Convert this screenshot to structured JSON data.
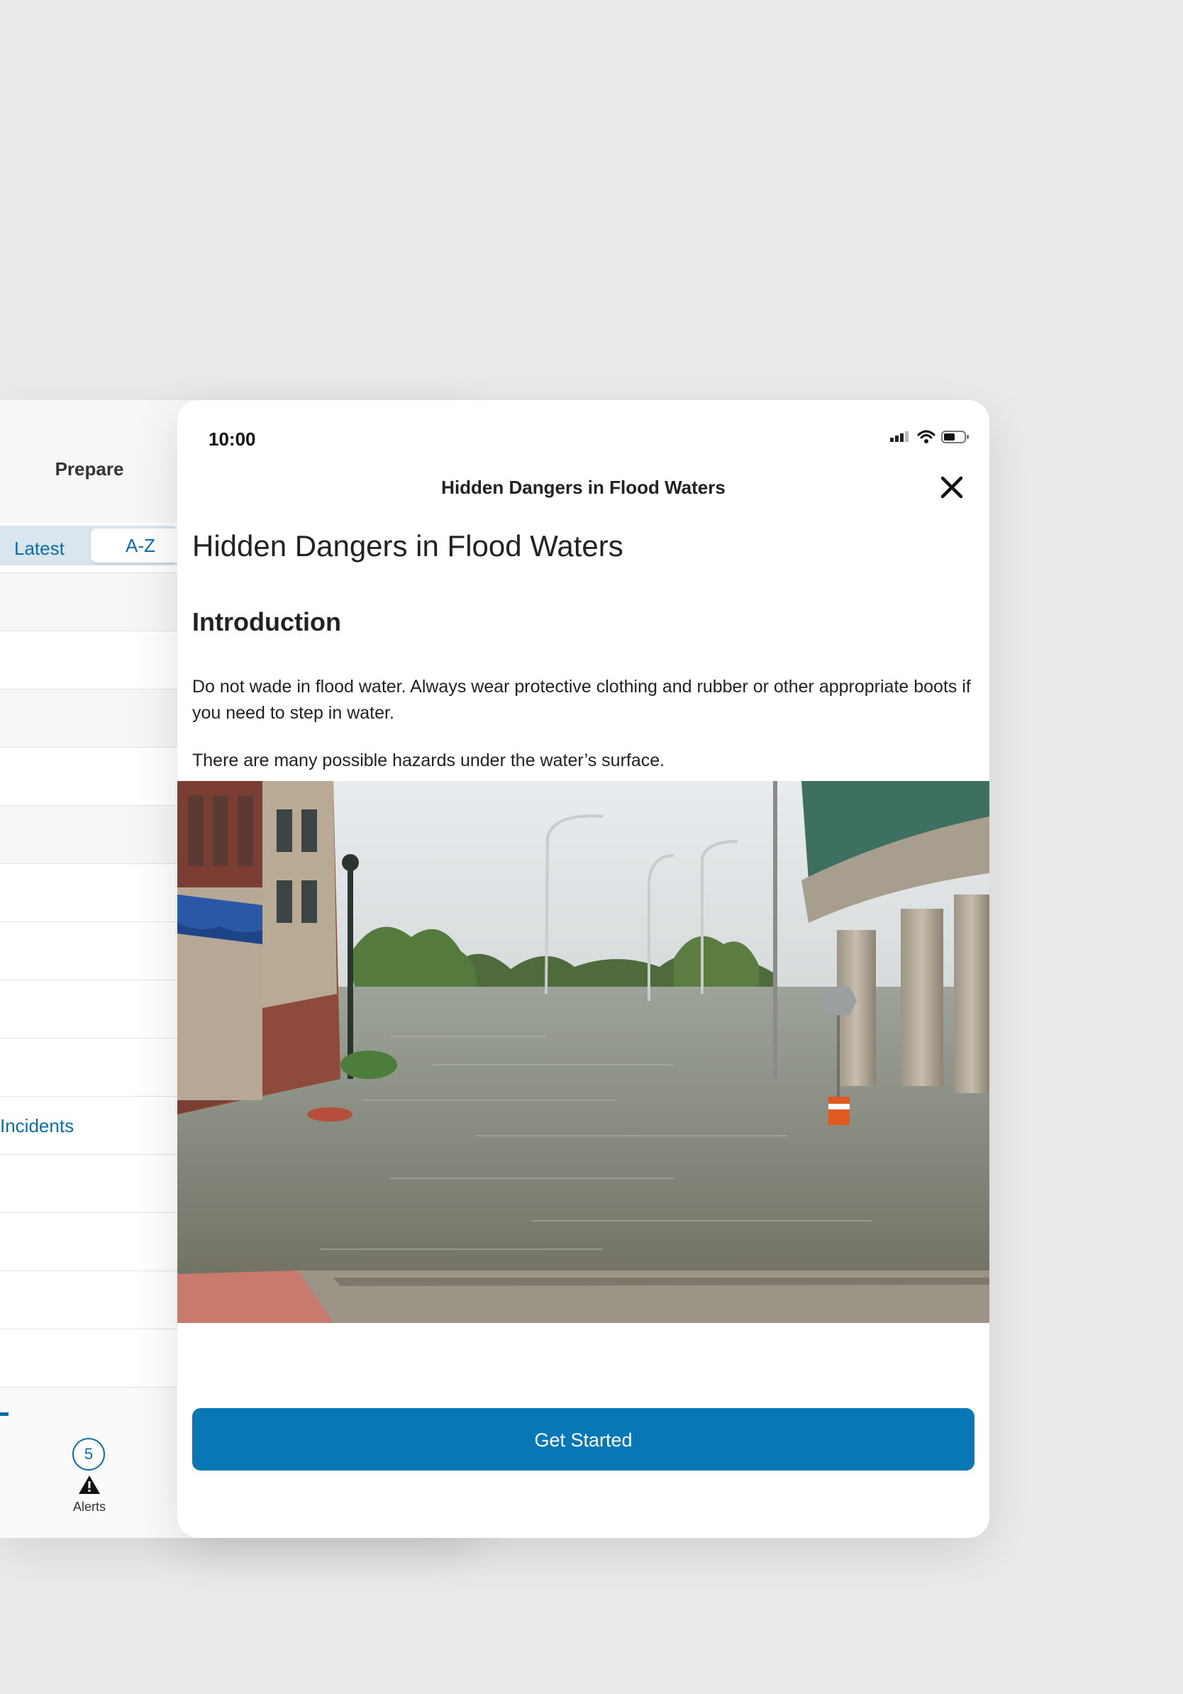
{
  "back_panel": {
    "title": "Prepare",
    "segmented": {
      "options": [
        "Latest",
        "A-Z"
      ],
      "selected": "A-Z"
    },
    "visible_row_label": "Incidents",
    "tab_bar": {
      "alerts_count": "5",
      "alerts_label": "Alerts"
    }
  },
  "status_bar": {
    "time": "10:00"
  },
  "modal": {
    "nav_title": "Hidden Dangers in Flood Waters",
    "heading": "Hidden Dangers in Flood Waters",
    "section_title": "Introduction",
    "paragraphs": [
      "Do not wade in flood water. Always wear protective clothing and rubber or other appropriate boots if you need to step in water.",
      "There are many possible hazards under the water’s surface."
    ],
    "cta_label": "Get Started"
  },
  "colors": {
    "accent": "#0777b5",
    "link": "#0a6ea8",
    "background": "#ebebeb"
  },
  "icons": [
    "close-icon",
    "signal-icon",
    "wifi-icon",
    "battery-icon",
    "alert-triangle-icon"
  ]
}
